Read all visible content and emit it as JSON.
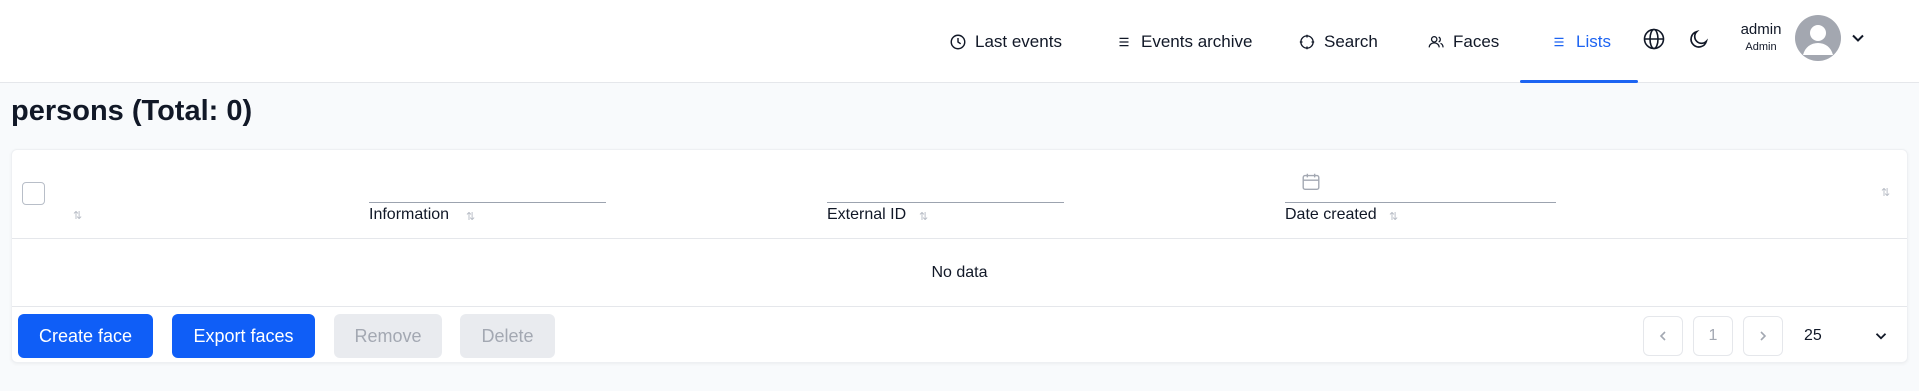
{
  "nav": {
    "items": [
      {
        "label": "Last events",
        "icon": "clock-icon"
      },
      {
        "label": "Events archive",
        "icon": "list-icon"
      },
      {
        "label": "Search",
        "icon": "search-icon"
      },
      {
        "label": "Faces",
        "icon": "users-icon"
      },
      {
        "label": "Lists",
        "icon": "list-icon",
        "active": true
      }
    ],
    "accent_color": "#1d64f2"
  },
  "user": {
    "name": "admin",
    "role": "Admin"
  },
  "page": {
    "title": "persons (Total: 0)"
  },
  "table": {
    "columns": [
      "Information",
      "External ID",
      "Date created"
    ],
    "empty_text": "No data"
  },
  "actions": {
    "create": "Create face",
    "export": "Export faces",
    "remove": "Remove",
    "delete": "Delete"
  },
  "pagination": {
    "current_page": "1",
    "page_size": "25"
  }
}
